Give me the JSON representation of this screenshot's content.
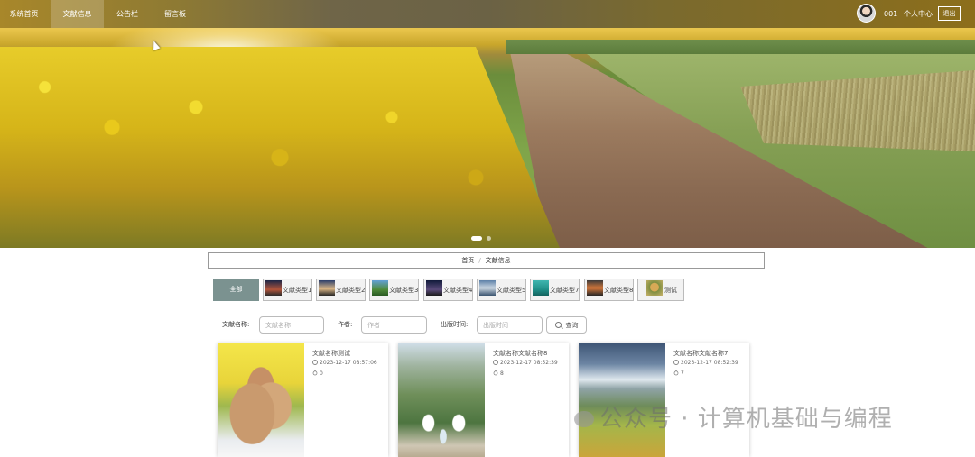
{
  "nav": {
    "items": [
      {
        "label": "系统首页"
      },
      {
        "label": "文献信息"
      },
      {
        "label": "公告栏"
      },
      {
        "label": "留言板"
      }
    ],
    "active_index": 1,
    "user": {
      "name": "001",
      "center_label": "个人中心",
      "logout_label": "退出"
    }
  },
  "banner": {
    "slides": 2,
    "active_slide": 0
  },
  "breadcrumb": {
    "home": "首页",
    "separator": "/",
    "current": "文献信息"
  },
  "categories": [
    {
      "label": "全部"
    },
    {
      "label": "文献类型1"
    },
    {
      "label": "文献类型2"
    },
    {
      "label": "文献类型3"
    },
    {
      "label": "文献类型4"
    },
    {
      "label": "文献类型5"
    },
    {
      "label": "文献类型7"
    },
    {
      "label": "文献类型8"
    },
    {
      "label": "测试"
    }
  ],
  "search": {
    "name_label": "文献名称:",
    "name_placeholder": "文献名称",
    "author_label": "作者:",
    "author_placeholder": "作者",
    "date_label": "出版时间:",
    "date_placeholder": "出版时间",
    "button_label": "查询"
  },
  "cards": [
    {
      "title": "文献名称测试",
      "time": "2023-12-17 08:57:06",
      "count": "0",
      "image": "rabbit"
    },
    {
      "title": "文献名称文献名称8",
      "time": "2023-12-17 08:52:39",
      "count": "8",
      "image": "family"
    },
    {
      "title": "文献名称文献名称7",
      "time": "2023-12-17 08:52:39",
      "count": "7",
      "image": "terrace"
    }
  ],
  "watermark": "公众号 · 计算机基础与编程",
  "icons": {
    "time": "clock-icon",
    "count": "heart-icon",
    "search": "search-icon"
  }
}
